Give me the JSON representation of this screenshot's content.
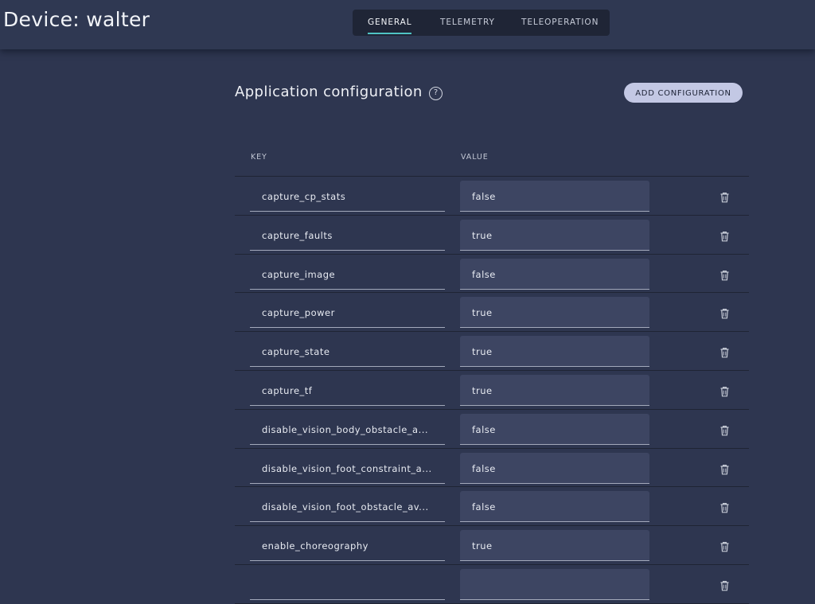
{
  "header": {
    "device_title": "Device: walter",
    "tabs": [
      {
        "label": "GENERAL",
        "active": true
      },
      {
        "label": "TELEMETRY",
        "active": false
      },
      {
        "label": "TELEOPERATION",
        "active": false
      }
    ]
  },
  "section": {
    "title": "Application configuration",
    "help_symbol": "?",
    "add_button": "ADD CONFIGURATION"
  },
  "table": {
    "columns": [
      "KEY",
      "VALUE"
    ],
    "rows": [
      {
        "key": "capture_cp_stats",
        "value": "false"
      },
      {
        "key": "capture_faults",
        "value": "true"
      },
      {
        "key": "capture_image",
        "value": "false"
      },
      {
        "key": "capture_power",
        "value": "true"
      },
      {
        "key": "capture_state",
        "value": "true"
      },
      {
        "key": "capture_tf",
        "value": "true"
      },
      {
        "key": "disable_vision_body_obstacle_a...",
        "value": "false"
      },
      {
        "key": "disable_vision_foot_constraint_a...",
        "value": "false"
      },
      {
        "key": "disable_vision_foot_obstacle_av...",
        "value": "false"
      },
      {
        "key": "enable_choreography",
        "value": "true"
      },
      {
        "key": "",
        "value": ""
      }
    ]
  },
  "icons": {
    "help": "question-circle-icon",
    "delete": "trash-icon"
  },
  "colors": {
    "background": "#2e3650",
    "accent": "#4fc3c4",
    "button": "#c3c8e4",
    "field": "#3d4562"
  }
}
